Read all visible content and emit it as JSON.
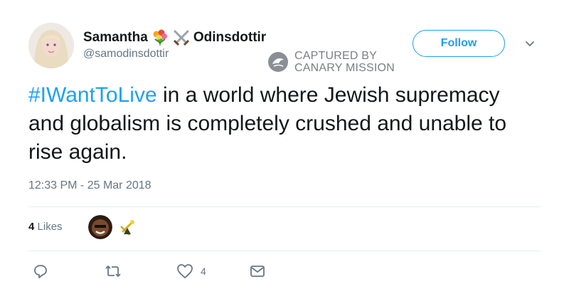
{
  "author": {
    "name_first": "Samantha",
    "name_last": "Odinsdottir",
    "handle": "@samodinsdottir",
    "emoji_icons": [
      "bouquet-icon",
      "crossed-swords-icon"
    ]
  },
  "follow_button": {
    "label": "Follow"
  },
  "watermark": {
    "line1": "CAPTURED BY",
    "line2": "CANARY MISSION"
  },
  "tweet": {
    "hashtag": "#IWantToLive",
    "text": " in a world where Jewish supremacy and globalism is completely crushed and unable to rise again."
  },
  "timestamp": "12:33 PM - 25 Mar 2018",
  "likes": {
    "count": "4",
    "label": "Likes"
  },
  "actions": {
    "reply_icon": "reply-icon",
    "retweet_icon": "retweet-icon",
    "like_icon": "heart-icon",
    "like_count": "4",
    "message_icon": "message-icon"
  },
  "colors": {
    "accent": "#1da1f2",
    "muted": "#657786",
    "text": "#14171a"
  }
}
